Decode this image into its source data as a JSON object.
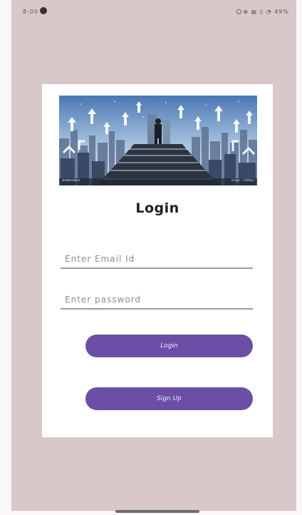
{
  "status_bar": {
    "time": "8:00",
    "right_icons": "⊗ ▤ ▯ ◔ 49%"
  },
  "hero": {
    "caption_left": "shutterstock",
    "caption_right": "image • 2000px"
  },
  "login": {
    "title": "Login",
    "email_placeholder": "Enter Email Id",
    "email_value": "",
    "password_placeholder": "Enter password",
    "password_value": "",
    "login_button_label": "Login",
    "signup_button_label": "Sign Up"
  },
  "colors": {
    "screen_background": "#d9c8ca",
    "card_background": "#ffffff",
    "accent": "#6b4fa6"
  }
}
